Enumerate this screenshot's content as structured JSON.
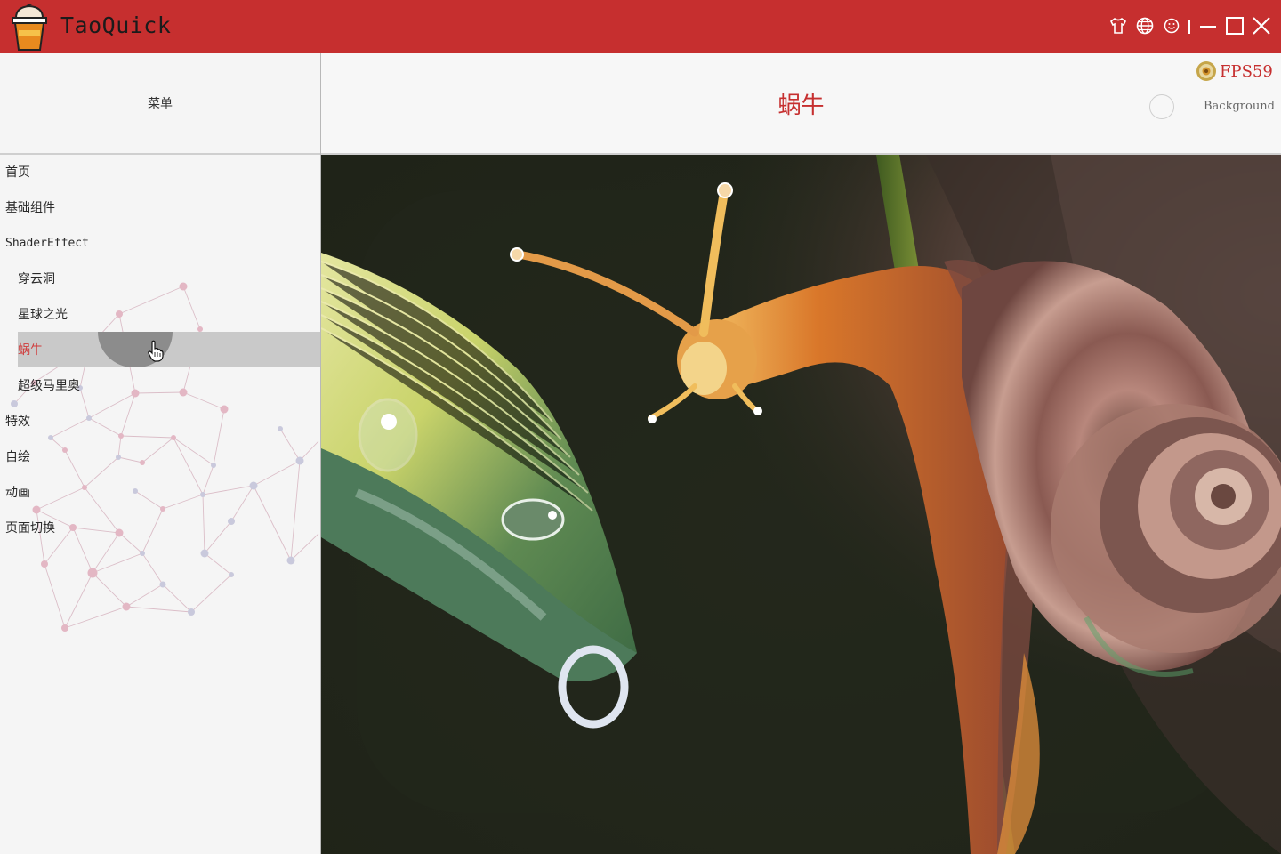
{
  "app": {
    "title": "TaoQuick",
    "colors": {
      "accent": "#c62f2f",
      "menu_bg": "#f5f5f5",
      "selected_bg": "#c9c9c9",
      "scene_bg": "#21241a"
    }
  },
  "titlebar": {
    "buttons": [
      {
        "name": "skin-button",
        "icon": "tshirt-icon"
      },
      {
        "name": "language-button",
        "icon": "globe-icon"
      },
      {
        "name": "about-button",
        "icon": "smiley-icon"
      },
      {
        "name": "minimize-button",
        "icon": "minimize-icon"
      },
      {
        "name": "maximize-button",
        "icon": "maximize-icon"
      },
      {
        "name": "close-button",
        "icon": "close-icon"
      }
    ]
  },
  "menu": {
    "header": "菜单",
    "items": [
      {
        "label": "首页",
        "level": 0
      },
      {
        "label": "基础组件",
        "level": 0
      },
      {
        "label": "ShaderEffect",
        "level": 0
      },
      {
        "label": "穿云洞",
        "level": 1
      },
      {
        "label": "星球之光",
        "level": 1
      },
      {
        "label": "蜗牛",
        "level": 1,
        "selected": true
      },
      {
        "label": "超级马里奥",
        "level": 1
      },
      {
        "label": "特效",
        "level": 0
      },
      {
        "label": "自绘",
        "level": 0
      },
      {
        "label": "动画",
        "level": 0
      },
      {
        "label": "页面切换",
        "level": 0
      }
    ]
  },
  "content": {
    "title": "蜗牛",
    "fps": "FPS59",
    "background_label": "Background"
  }
}
